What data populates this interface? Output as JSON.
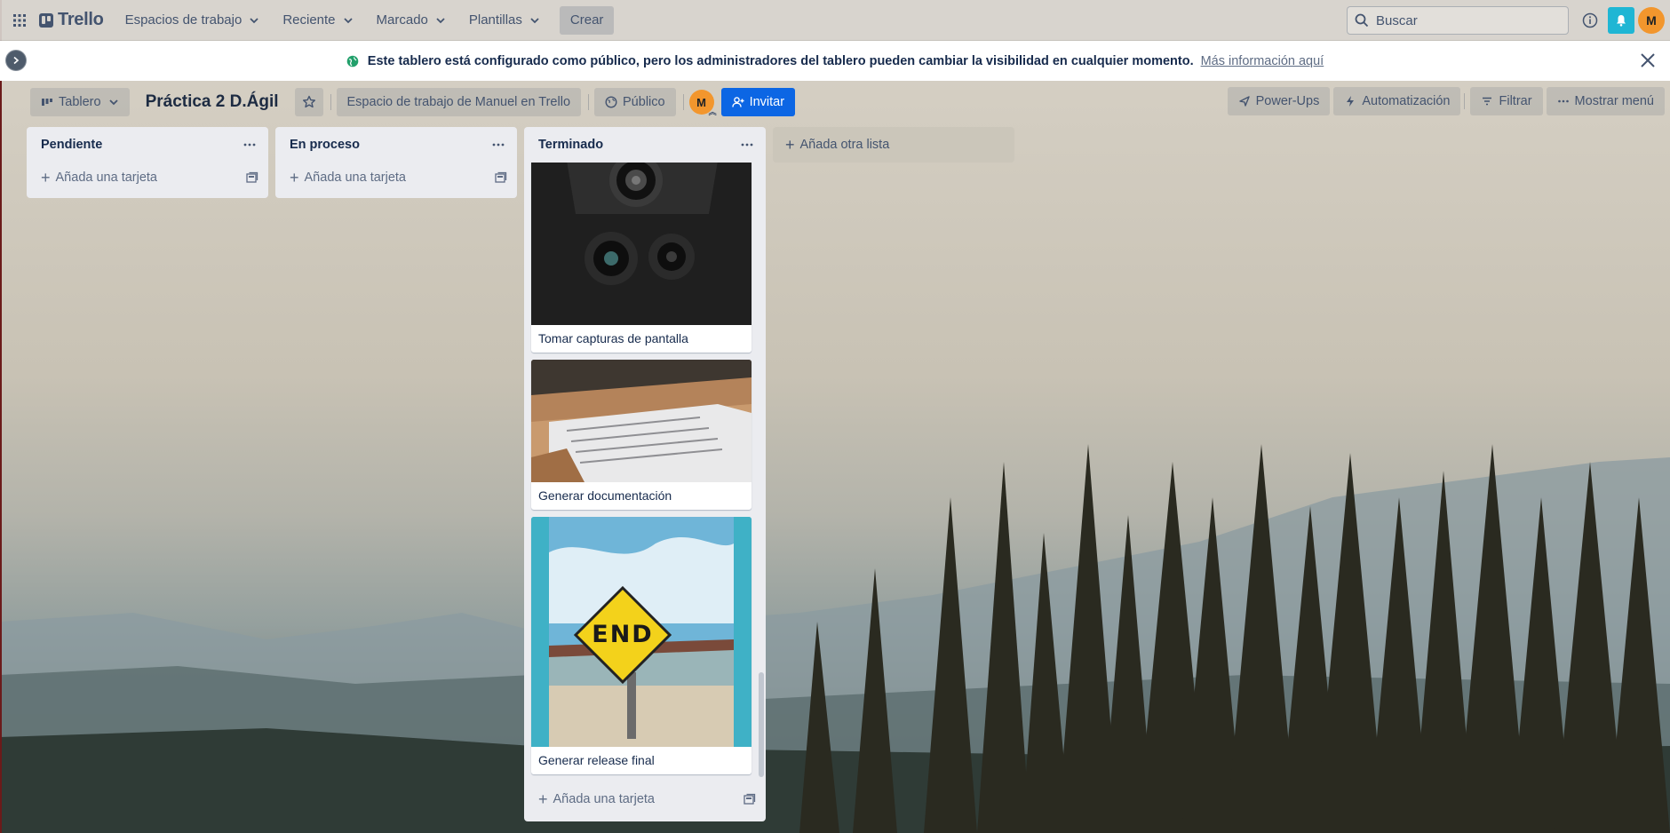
{
  "nav": {
    "logo": "Trello",
    "menus": [
      "Espacios de trabajo",
      "Reciente",
      "Marcado",
      "Plantillas"
    ],
    "create": "Crear",
    "search_placeholder": "Buscar",
    "avatar_initial": "M"
  },
  "banner": {
    "text": "Este tablero está configurado como público, pero los administradores del tablero pueden cambiar la visibilidad en cualquier momento.",
    "link": "Más información aquí"
  },
  "board": {
    "view": "Tablero",
    "title": "Práctica 2 D.Ágil",
    "workspace": "Espacio de trabajo de Manuel en Trello",
    "visibility": "Público",
    "member_initial": "M",
    "invite": "Invitar",
    "powerups": "Power-Ups",
    "automation": "Automatización",
    "filter": "Filtrar",
    "menu": "Mostrar menú"
  },
  "lists": [
    {
      "title": "Pendiente",
      "add_card": "Añada una tarjeta",
      "cards": []
    },
    {
      "title": "En proceso",
      "add_card": "Añada una tarjeta",
      "cards": []
    },
    {
      "title": "Terminado",
      "add_card": "Añada una tarjeta",
      "cards": [
        {
          "title": "Tomar capturas de pantalla",
          "cover": "camera-lenses"
        },
        {
          "title": "Generar documentación",
          "cover": "documents-folders"
        },
        {
          "title": "Generar release final",
          "cover": "end-road-sign"
        }
      ]
    }
  ],
  "cover_texts": {
    "end_sign": "END"
  },
  "add_list": "Añada otra lista",
  "colors": {
    "accent": "#0c66e4",
    "notification": "#1fb6d4",
    "avatar": "#f2962d",
    "list_bg": "#ebecf0",
    "public_globe": "#22a06b"
  }
}
